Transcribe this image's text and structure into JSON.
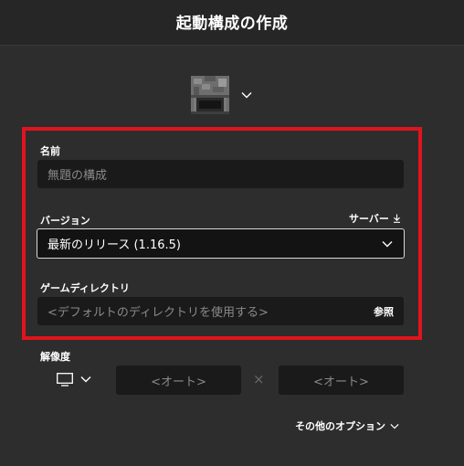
{
  "header": {
    "title": "起動構成の作成"
  },
  "icon_picker": {
    "icon": "furnace-icon"
  },
  "name_field": {
    "label": "名前",
    "placeholder": "無題の構成"
  },
  "version_field": {
    "label": "バージョン",
    "value": "最新のリリース (1.16.5)",
    "server_link": "サーバー"
  },
  "game_dir_field": {
    "label": "ゲームディレクトリ",
    "placeholder": "<デフォルトのディレクトリを使用する>",
    "browse_label": "参照"
  },
  "resolution": {
    "label": "解像度",
    "width_placeholder": "<オート>",
    "height_placeholder": "<オート>",
    "separator": "×"
  },
  "more_options": {
    "label": "その他のオプション"
  },
  "colors": {
    "background": "#2d2d2d",
    "highlight": "#e0141e",
    "field_bg": "#1a1a1a"
  }
}
